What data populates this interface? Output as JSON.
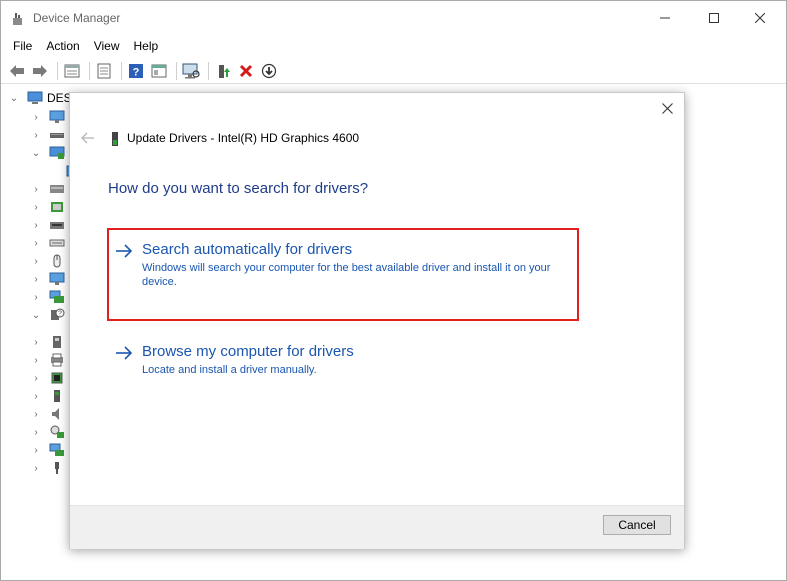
{
  "window": {
    "title": "Device Manager",
    "minimize_glyph": "—",
    "maximize_glyph": "☐",
    "close_glyph": "✕"
  },
  "menu": {
    "items": [
      {
        "label": "File"
      },
      {
        "label": "Action"
      },
      {
        "label": "View"
      },
      {
        "label": "Help"
      }
    ]
  },
  "toolbar": {
    "icons": [
      "back-arrow-icon",
      "forward-arrow-icon",
      "properties-icon",
      "show-hide-icon",
      "help-icon",
      "properties-sheet-icon",
      "scan-hardware-icon",
      "update-driver-icon",
      "uninstall-icon",
      "disable-device-icon"
    ]
  },
  "tree": {
    "root_label": "DES"
  },
  "dialog": {
    "header_title": "Update Drivers - Intel(R) HD Graphics 4600",
    "question": "How do you want to search for drivers?",
    "option_auto": {
      "title": "Search automatically for drivers",
      "description": "Windows will search your computer for the best available driver and install it on your device."
    },
    "option_browse": {
      "title": "Browse my computer for drivers",
      "description": "Locate and install a driver manually."
    },
    "cancel_label": "Cancel",
    "highlight_color": "#e0201e",
    "link_color": "#1a56b0"
  }
}
